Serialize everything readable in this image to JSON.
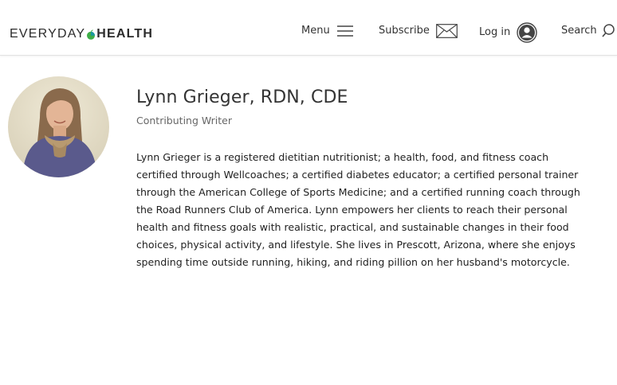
{
  "header": {
    "logo": {
      "part1": "EVERYDAY",
      "part2": "HEALTH"
    },
    "nav": {
      "menu_label": "Menu",
      "subscribe_label": "Subscribe",
      "login_label": "Log in",
      "search_label": "Search"
    }
  },
  "author": {
    "name": "Lynn Grieger, RDN, CDE",
    "role": "Contributing Writer",
    "bio": "Lynn Grieger is a registered dietitian nutritionist; a health, food, and fitness coach certified through Wellcoaches; a certified diabetes educator; a certified personal trainer through the American College of Sports Medicine; and a certified running coach through the Road Runners Club of America. Lynn empowers her clients to reach their personal health and fitness goals with realistic, practical, and sustainable changes in their food choices, physical activity, and lifestyle. She lives in Prescott, Arizona, where she enjoys spending time outside running, hiking, and riding pillion on her husband's motorcycle."
  },
  "colors": {
    "logo_text": "#2b2b2b",
    "apple_green": "#3fae49",
    "apple_teal": "#1a9aa0",
    "divider": "#e2e2e2"
  }
}
